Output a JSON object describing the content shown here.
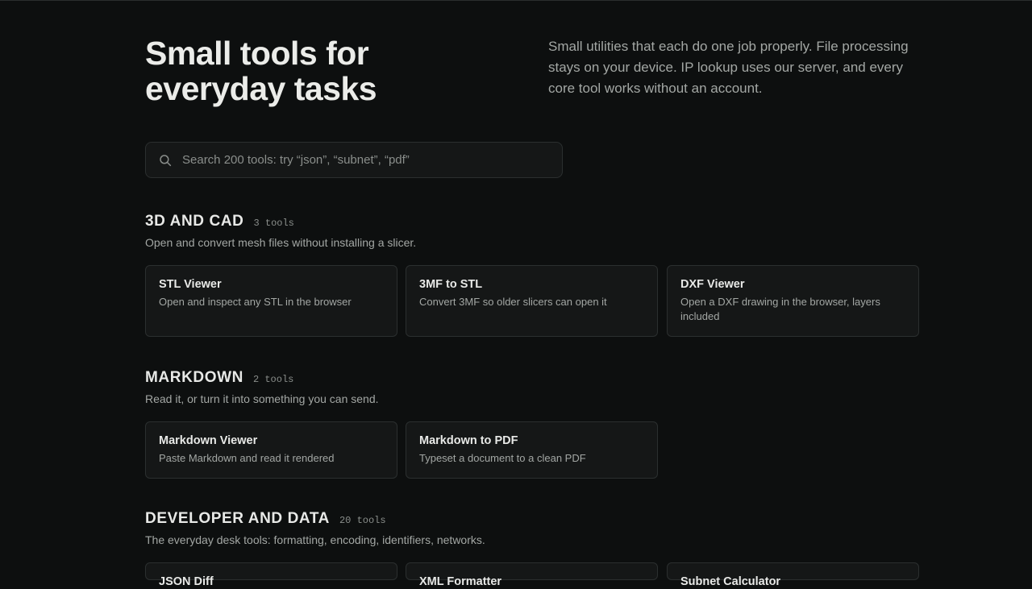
{
  "hero": {
    "title_line1": "Small tools for",
    "title_line2": "everyday tasks",
    "description": "Small utilities that each do one job properly. File processing stays on your device. IP lookup uses our server, and every core tool works without an account."
  },
  "search": {
    "placeholder": "Search 200 tools: try “json”, “subnet”, “pdf”",
    "value": ""
  },
  "sections": [
    {
      "title": "3D AND CAD",
      "count": "3 tools",
      "description": "Open and convert mesh files without installing a slicer.",
      "tools": [
        {
          "name": "STL Viewer",
          "description": "Open and inspect any STL in the browser"
        },
        {
          "name": "3MF to STL",
          "description": "Convert 3MF so older slicers can open it"
        },
        {
          "name": "DXF Viewer",
          "description": "Open a DXF drawing in the browser, layers included"
        }
      ]
    },
    {
      "title": "MARKDOWN",
      "count": "2 tools",
      "description": "Read it, or turn it into something you can send.",
      "tools": [
        {
          "name": "Markdown Viewer",
          "description": "Paste Markdown and read it rendered"
        },
        {
          "name": "Markdown to PDF",
          "description": "Typeset a document to a clean PDF"
        }
      ]
    },
    {
      "title": "DEVELOPER AND DATA",
      "count": "20 tools",
      "description": "The everyday desk tools: formatting, encoding, identifiers, networks.",
      "tools": [
        {
          "name": "JSON Diff",
          "description": ""
        },
        {
          "name": "XML Formatter",
          "description": ""
        },
        {
          "name": "Subnet Calculator",
          "description": ""
        }
      ]
    }
  ]
}
